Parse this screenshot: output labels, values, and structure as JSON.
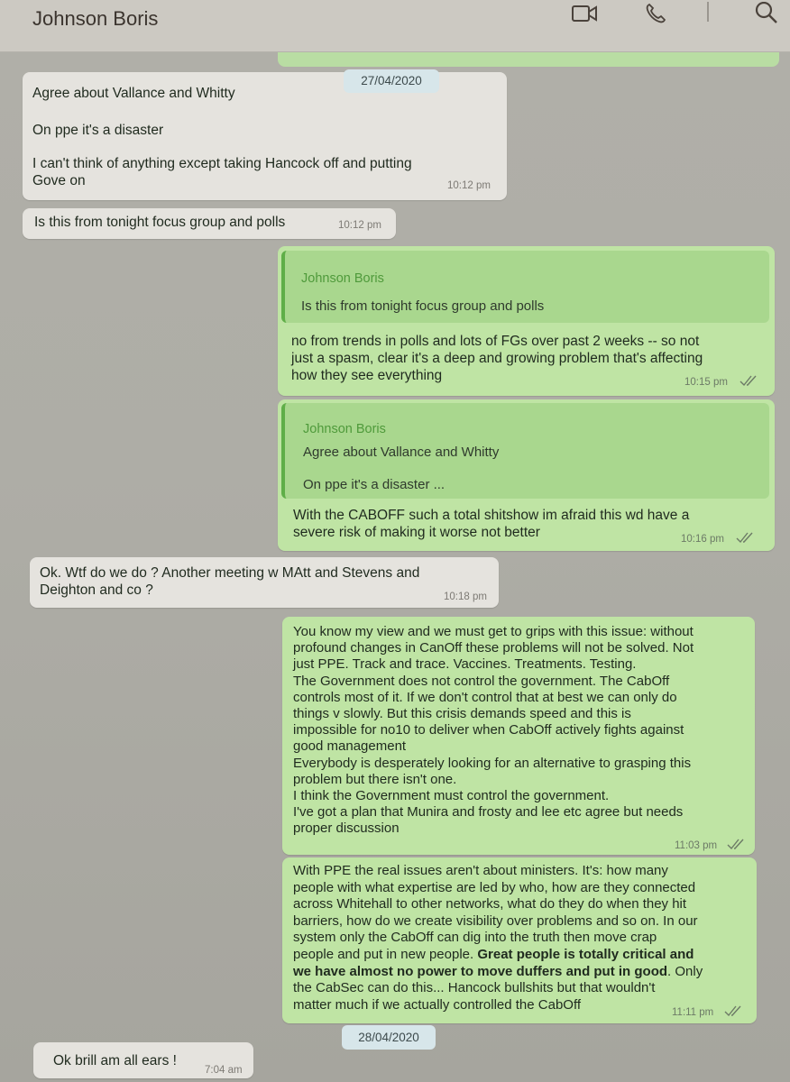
{
  "header": {
    "title": "Johnson Boris",
    "icons": [
      "video-icon",
      "phone-icon",
      "search-icon"
    ]
  },
  "dates": [
    "27/04/2020",
    "28/04/2020"
  ],
  "messages": [
    {
      "direction": "in",
      "lines": [
        "Agree about Vallance and Whitty",
        "On ppe it's a disaster",
        "I can't think of anything except taking Hancock off and putting\nGove on"
      ],
      "time": "10:12 pm"
    },
    {
      "direction": "in",
      "text": "Is this from tonight focus group and polls",
      "time": "10:12 pm"
    },
    {
      "direction": "out",
      "quote_author": "Johnson Boris",
      "quote_text": "Is this from tonight focus group and polls",
      "text": "no from trends in polls and lots of FGs over past 2 weeks  -- so not\njust a spasm, clear it's a deep and growing problem that's affecting\nhow they see everything",
      "time": "10:15 pm"
    },
    {
      "direction": "out",
      "quote_author": "Johnson Boris",
      "quote_text": "Agree about Vallance and Whitty",
      "quote_text2": "On ppe it's a disaster ...",
      "text": "With the CABOFF such a total shitshow im afraid this wd have a\nsevere risk of making it worse not better",
      "time": "10:16 pm"
    },
    {
      "direction": "in",
      "text": "Ok. Wtf do we do ? Another meeting w MAtt and Stevens and\nDeighton and co ?",
      "time": "10:18 pm"
    },
    {
      "direction": "out",
      "text": "You know my view and we must get to grips with this issue: without\nprofound changes in CanOff these problems will not be solved. Not\njust PPE. Track and trace. Vaccines. Treatments. Testing.\nThe Government does not control the government. The CabOff\ncontrols most of it. If we don't control that at best we can only do\nthings v slowly. But this crisis demands speed and this is\nimpossible for no10 to deliver when CabOff actively fights against\ngood management\nEverybody is desperately looking for an alternative to grasping this\nproblem but there isn't one.\nI think the Government must control the government.\nI've got a plan that Munira and frosty and lee etc agree but needs\nproper discussion",
      "time": "11:03 pm"
    },
    {
      "direction": "out",
      "text_normal": "With PPE the real issues aren't about ministers. It's: how many\npeople with what expertise are led by who, how are they connected\nacross Whitehall to other networks, what do they do when they hit\nbarriers, how do we create visibility over problems and so on. In our\nsystem only the CabOff can dig into the truth then move crap\npeople and put in new people. ",
      "text_bold": "Great people is totally critical and\nwe have almost no power to move duffers and put in good",
      "text_tail": ". Only\nthe CabSec can do this... Hancock bullshits but that wouldn't\nmatter much if we actually controlled the CabOff",
      "time": "11:11 pm"
    },
    {
      "direction": "in",
      "text": "Ok brill am all ears !",
      "time": "7:04 am"
    }
  ],
  "colors": {
    "incoming_bubble": "#e5e3de",
    "outgoing_bubble": "#bfe4a4",
    "quote_accent": "#5fae48",
    "background": "#aeada6"
  }
}
